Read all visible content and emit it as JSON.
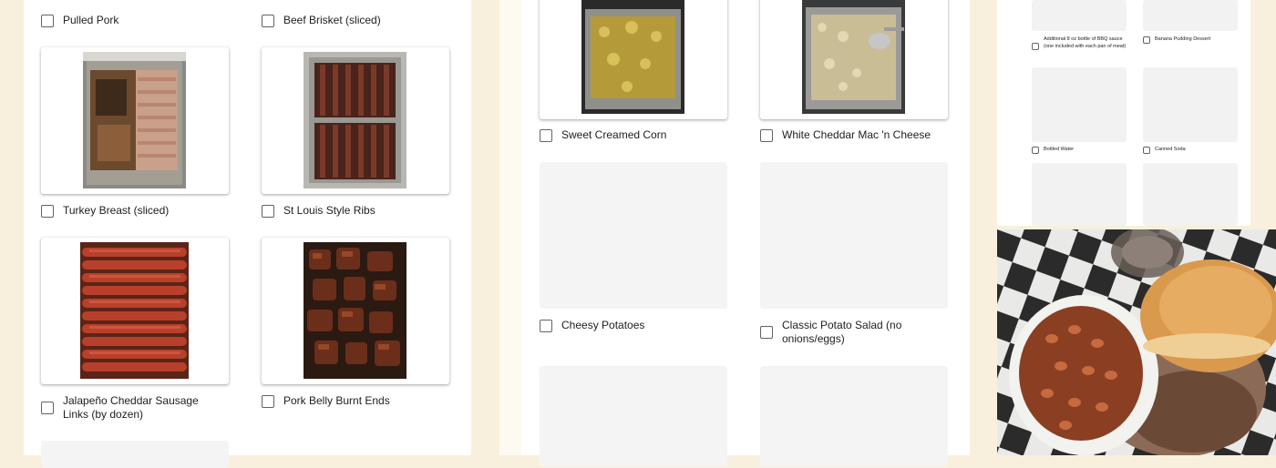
{
  "left_column": {
    "options": [
      {
        "label": "Pulled Pork"
      },
      {
        "label": "Beef Brisket (sliced)"
      },
      {
        "label": "Turkey Breast (sliced)"
      },
      {
        "label": "St Louis Style Ribs"
      },
      {
        "label": "Jalapeño Cheddar Sausage Links (by dozen)"
      },
      {
        "label": "Pork Belly Burnt Ends"
      }
    ]
  },
  "middle_column": {
    "options": [
      {
        "label": "Sweet Creamed Corn"
      },
      {
        "label": "White Cheddar Mac 'n Cheese"
      },
      {
        "label": "Cheesy Potatoes"
      },
      {
        "label": "Classic Potato Salad (no onions/eggs)"
      }
    ]
  },
  "right_thumbnail": {
    "options": [
      {
        "label": "Additional 8 oz bottle of BBQ sauce (one included with each pan of meat)"
      },
      {
        "label": "Banana Pudding Dessert"
      },
      {
        "label": "Bottled Water"
      },
      {
        "label": "Canned Soda"
      }
    ]
  },
  "colors": {
    "page_background": "#f8f0dc",
    "panel": "#ffffff",
    "checkbox_border": "#5f6368",
    "text": "#202124"
  },
  "icons": [
    "checkbox-icon"
  ]
}
